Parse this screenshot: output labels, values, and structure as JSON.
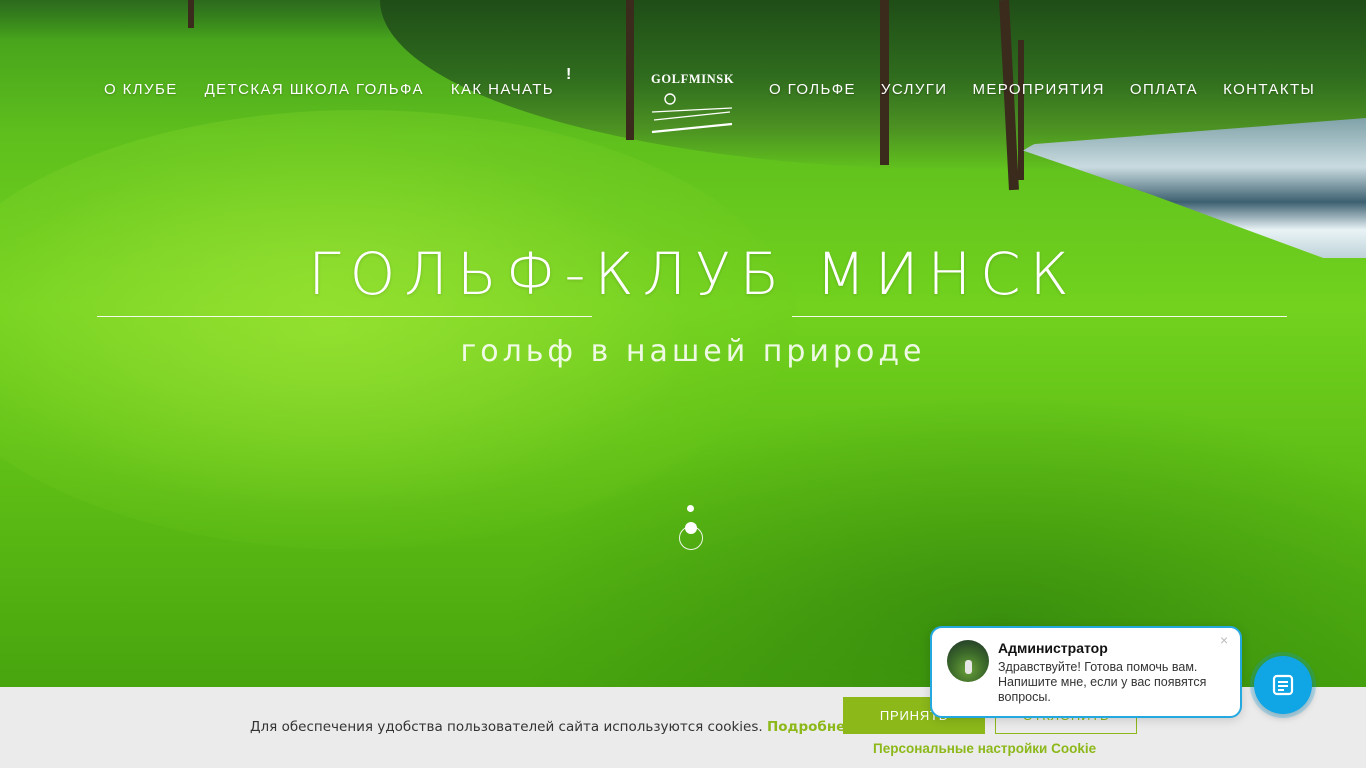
{
  "nav": {
    "left": [
      "О КЛУБЕ",
      "ДЕТСКАЯ ШКОЛА ГОЛЬФА",
      "КАК НАЧАТЬ"
    ],
    "badge": "!",
    "right": [
      "О ГОЛЬФЕ",
      "УСЛУГИ",
      "МЕРОПРИЯТИЯ",
      "ОПЛАТА",
      "КОНТАКТЫ"
    ]
  },
  "logo": {
    "text": "GOLFMINSK"
  },
  "hero": {
    "title": "ГОЛЬФ-КЛУБ МИНСК",
    "subtitle": "гольф в нашей природе"
  },
  "cookie": {
    "text": "Для обеспечения удобства пользователей сайта используются cookies.",
    "more": "Подробнее",
    "accept": "ПРИНЯТЬ",
    "decline": "ОТКЛОНИТЬ",
    "settings": "Персональные настройки Cookie"
  },
  "chat": {
    "name": "Администратор",
    "message": "Здравствуйте! Готова помочь вам. Напишите мне, если у вас появятся вопросы.",
    "close": "×"
  },
  "colors": {
    "accent": "#8cb81a",
    "chat": "#10a6e6"
  }
}
